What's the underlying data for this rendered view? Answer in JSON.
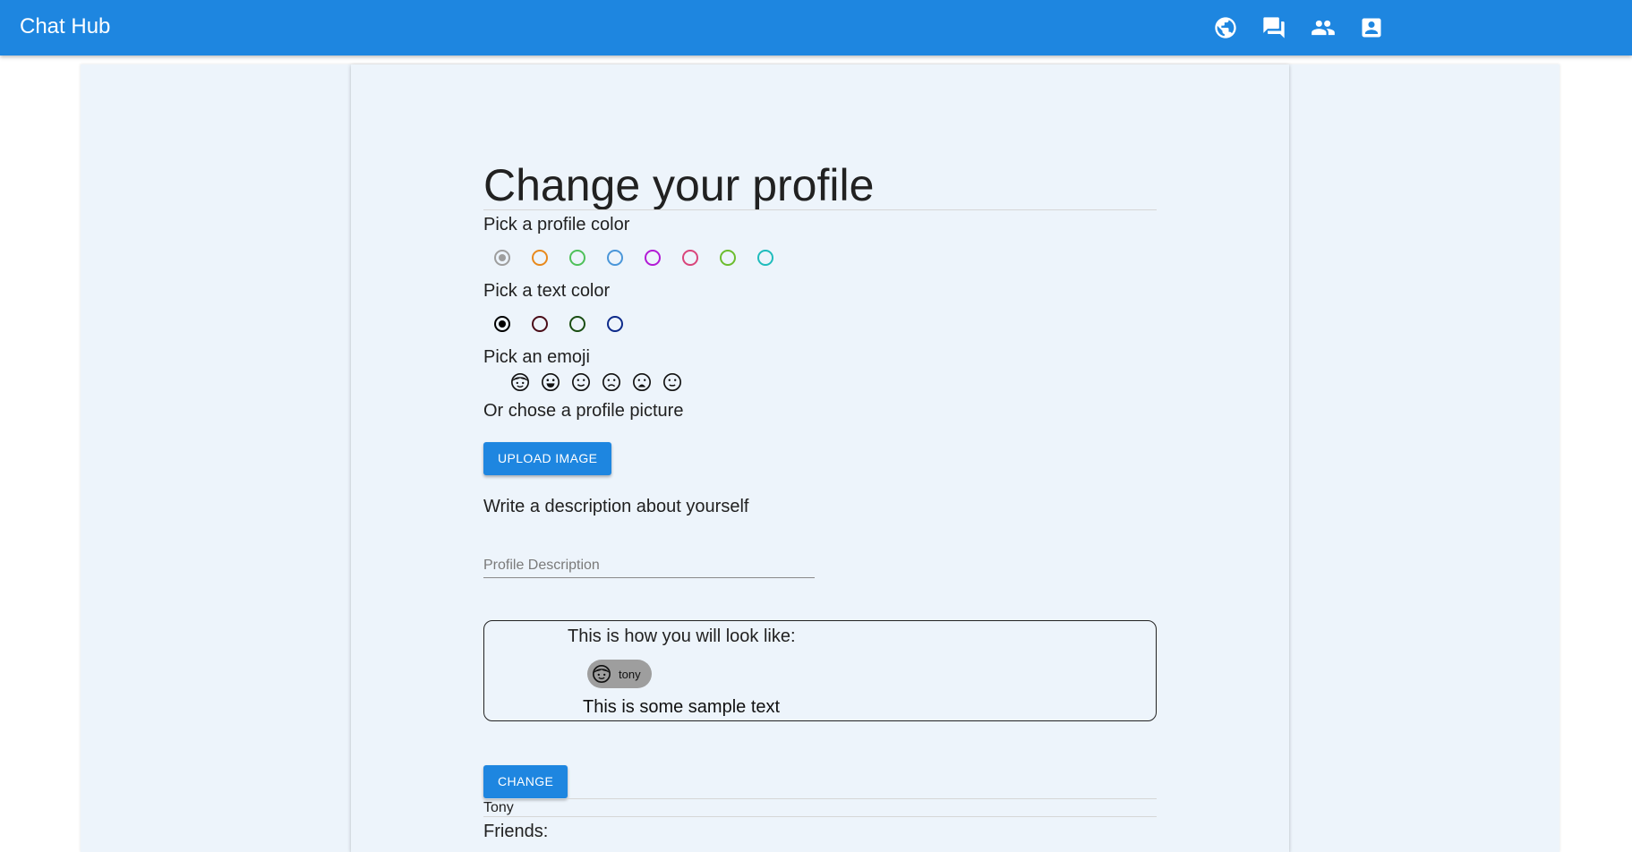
{
  "app": {
    "title": "Chat Hub"
  },
  "nav": {
    "icons": [
      "globe-icon",
      "forum-icon",
      "people-icon",
      "account-box-icon"
    ],
    "color": "#ffffff"
  },
  "colors": {
    "appbar": "#1e86e0",
    "page_bg": "#edf4fb",
    "button": "#1e86e0"
  },
  "profile": {
    "heading": "Change your profile",
    "profile_color_label": "Pick a profile color",
    "profile_colors": [
      {
        "name": "gray",
        "hex": "#9e9e9e",
        "selected": true
      },
      {
        "name": "orange",
        "hex": "#e8891c",
        "selected": false
      },
      {
        "name": "green",
        "hex": "#4fc15a",
        "selected": false
      },
      {
        "name": "blue",
        "hex": "#4a96d9",
        "selected": false
      },
      {
        "name": "purple",
        "hex": "#b21ad6",
        "selected": false
      },
      {
        "name": "pink",
        "hex": "#d9457b",
        "selected": false
      },
      {
        "name": "lime",
        "hex": "#6cbd2e",
        "selected": false
      },
      {
        "name": "teal",
        "hex": "#1fbcbc",
        "selected": false
      }
    ],
    "text_color_label": "Pick a text color",
    "text_colors": [
      {
        "name": "black",
        "hex": "#000000",
        "selected": true
      },
      {
        "name": "maroon",
        "hex": "#4a0d18",
        "selected": false
      },
      {
        "name": "dark-green",
        "hex": "#1a4d12",
        "selected": false
      },
      {
        "name": "navy",
        "hex": "#0d2a8a",
        "selected": false
      }
    ],
    "emoji_label": "Pick an emoji",
    "emojis": [
      "boy-face-icon",
      "grinning-face-icon",
      "slight-smile-icon",
      "frowning-face-icon",
      "anguished-face-icon",
      "neutral-face-icon"
    ],
    "picture_label": "Or chose a profile picture",
    "upload_button": "UPLOAD IMAGE",
    "description_label": "Write a description about yourself",
    "description": {
      "placeholder": "Profile Description",
      "value": ""
    },
    "preview": {
      "title": "This is how you will look like:",
      "name": "tony",
      "sample_text": "This is some sample text"
    },
    "change_button": "CHANGE",
    "username": "Tony",
    "friends_label": "Friends:"
  }
}
